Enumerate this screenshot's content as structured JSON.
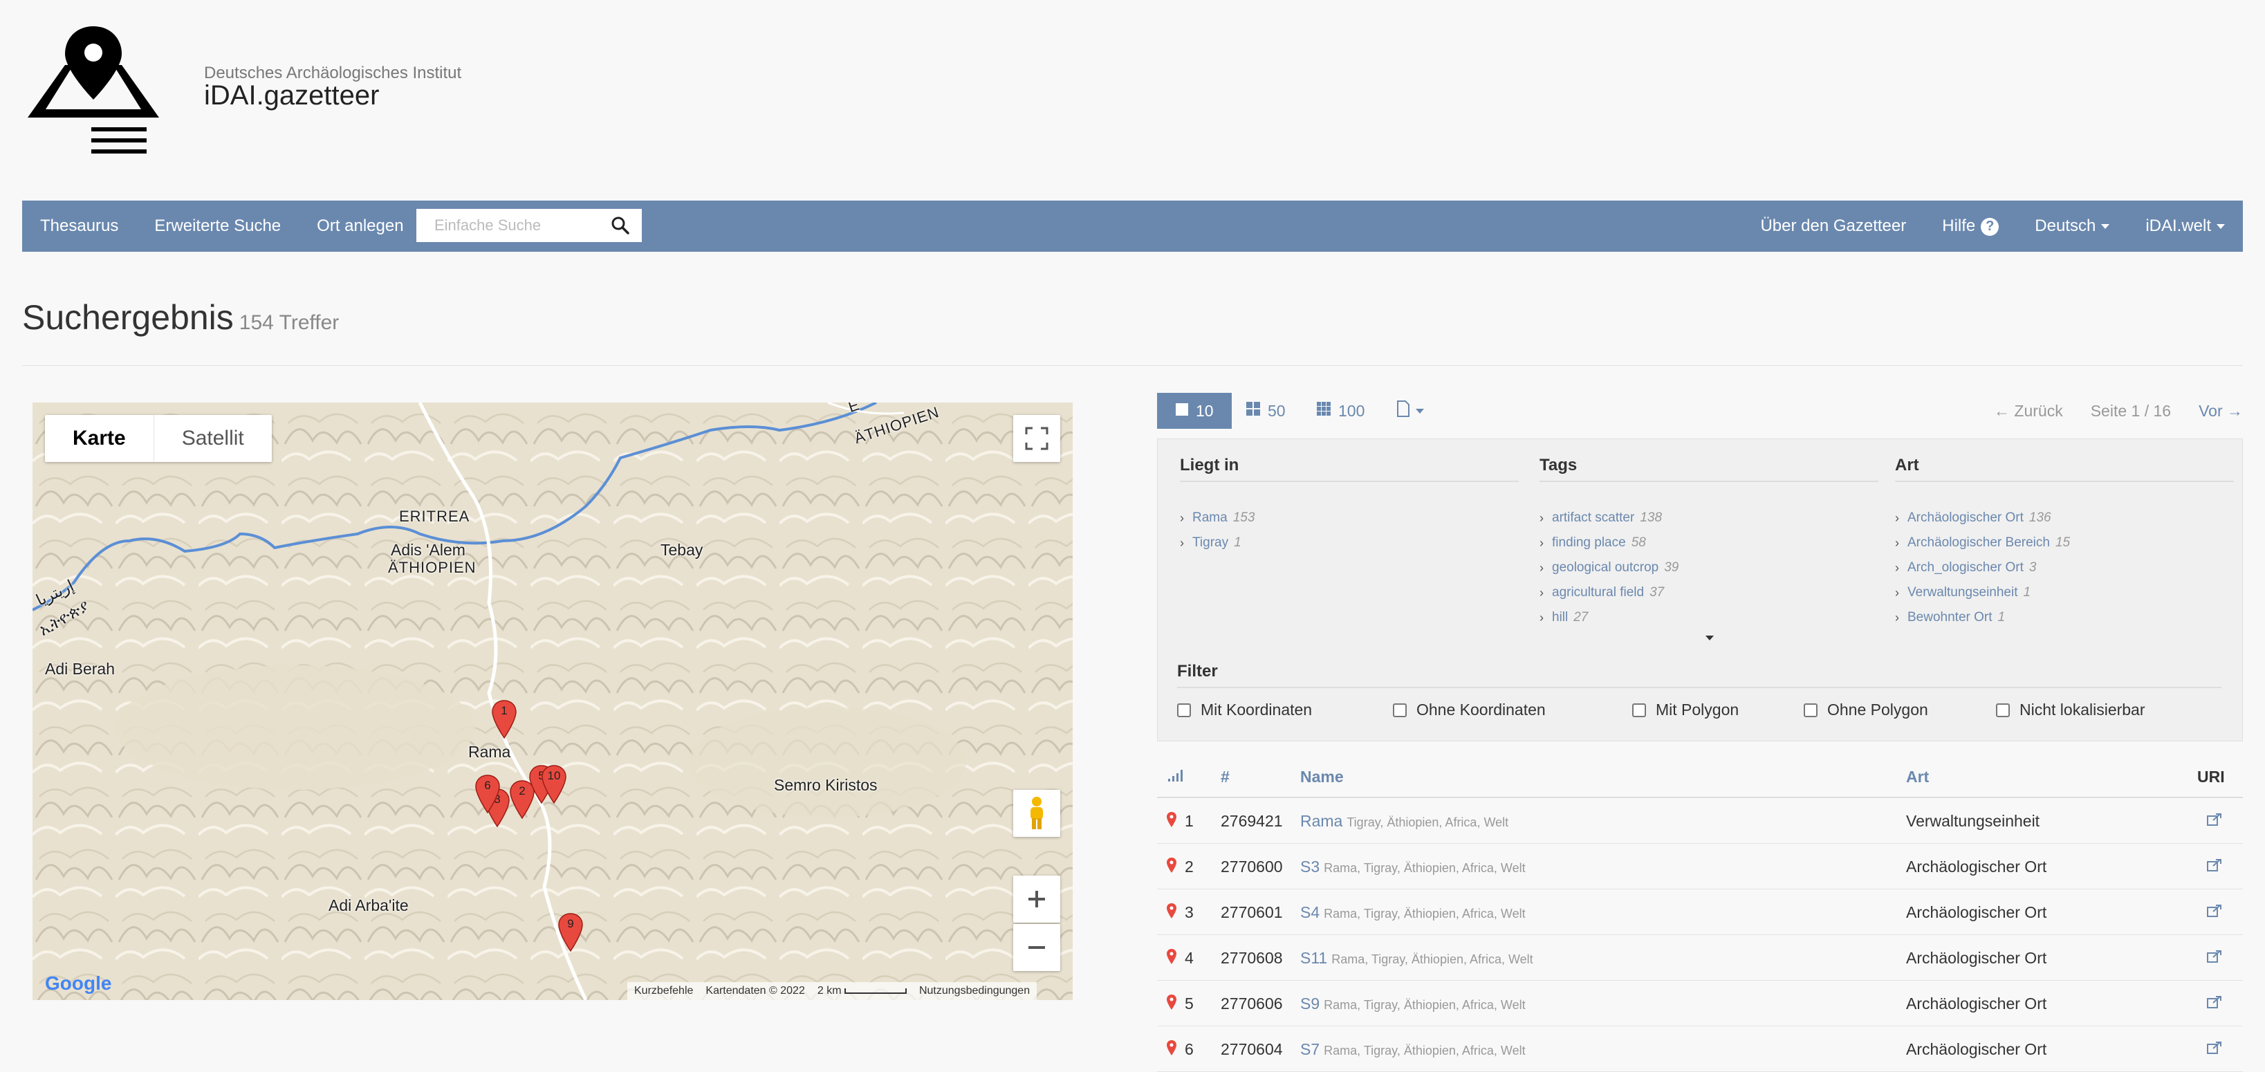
{
  "header": {
    "org": "Deutsches Archäologisches Institut",
    "title": "iDAI.gazetteer"
  },
  "nav": {
    "thesaurus": "Thesaurus",
    "advanced_search": "Erweiterte Suche",
    "create_place": "Ort anlegen",
    "search_placeholder": "Einfache Suche",
    "about": "Über den Gazetteer",
    "help": "Hilfe",
    "language": "Deutsch",
    "world": "iDAI.welt"
  },
  "result": {
    "title": "Suchergebnis",
    "hits": "154 Treffer"
  },
  "map": {
    "type_map": "Karte",
    "type_satellite": "Satellit",
    "labels": {
      "eritrea": "ERITREA",
      "adis_alem": "Adis 'Alem",
      "aethiopien": "ÄTHIOPIEN",
      "aethiopien_ne": "ÄTHIOPIEN",
      "eritrea_ne": "E",
      "tebay": "Tebay",
      "adi_berah": "Adi Berah",
      "rama": "Rama",
      "semro": "Semro Kiristos",
      "adi_arbaite": "Adi Arba'ite",
      "amharic": "ኢትዮጵያ",
      "arabic": "إريتريا"
    },
    "markers": [
      "1",
      "2",
      "3",
      "5",
      "6",
      "10",
      "9"
    ],
    "footer": {
      "shortcuts": "Kurzbefehle",
      "mapdata": "Kartendaten © 2022",
      "scale": "2 km",
      "terms": "Nutzungsbedingungen"
    },
    "google": "Google"
  },
  "pager": {
    "opt10": "10",
    "opt50": "50",
    "opt100": "100",
    "prev": "← Zurück",
    "page": "Seite 1 / 16",
    "next": "Vor →"
  },
  "facets": {
    "liegt_in": {
      "title": "Liegt in",
      "items": [
        {
          "label": "Rama",
          "count": "153"
        },
        {
          "label": "Tigray",
          "count": "1"
        }
      ]
    },
    "tags": {
      "title": "Tags",
      "items": [
        {
          "label": "artifact scatter",
          "count": "138"
        },
        {
          "label": "finding place",
          "count": "58"
        },
        {
          "label": "geological outcrop",
          "count": "39"
        },
        {
          "label": "agricultural field",
          "count": "37"
        },
        {
          "label": "hill",
          "count": "27"
        }
      ]
    },
    "art": {
      "title": "Art",
      "items": [
        {
          "label": "Archäologischer Ort",
          "count": "136"
        },
        {
          "label": "Archäologischer Bereich",
          "count": "15"
        },
        {
          "label": "Arch_ologischer Ort",
          "count": "3"
        },
        {
          "label": "Verwaltungseinheit",
          "count": "1"
        },
        {
          "label": "Bewohnter Ort",
          "count": "1"
        }
      ]
    }
  },
  "filter": {
    "title": "Filter",
    "options": [
      "Mit Koordinaten",
      "Ohne Koordinaten",
      "Mit Polygon",
      "Ohne Polygon",
      "Nicht lokalisierbar"
    ]
  },
  "table": {
    "headers": {
      "num": "#",
      "name": "Name",
      "art": "Art",
      "uri": "URI"
    },
    "rows": [
      {
        "idx": "1",
        "id": "2769421",
        "name": "Rama",
        "path": "Tigray, Äthiopien, Africa, Welt",
        "art": "Verwaltungseinheit"
      },
      {
        "idx": "2",
        "id": "2770600",
        "name": "S3",
        "path": "Rama, Tigray, Äthiopien, Africa, Welt",
        "art": "Archäologischer Ort"
      },
      {
        "idx": "3",
        "id": "2770601",
        "name": "S4",
        "path": "Rama, Tigray, Äthiopien, Africa, Welt",
        "art": "Archäologischer Ort"
      },
      {
        "idx": "4",
        "id": "2770608",
        "name": "S11",
        "path": "Rama, Tigray, Äthiopien, Africa, Welt",
        "art": "Archäologischer Ort"
      },
      {
        "idx": "5",
        "id": "2770606",
        "name": "S9",
        "path": "Rama, Tigray, Äthiopien, Africa, Welt",
        "art": "Archäologischer Ort"
      },
      {
        "idx": "6",
        "id": "2770604",
        "name": "S7",
        "path": "Rama, Tigray, Äthiopien, Africa, Welt",
        "art": "Archäologischer Ort"
      }
    ]
  },
  "colors": {
    "nav": "#6a88ae",
    "marker": "#e8493f",
    "river": "#5b8fd6"
  }
}
